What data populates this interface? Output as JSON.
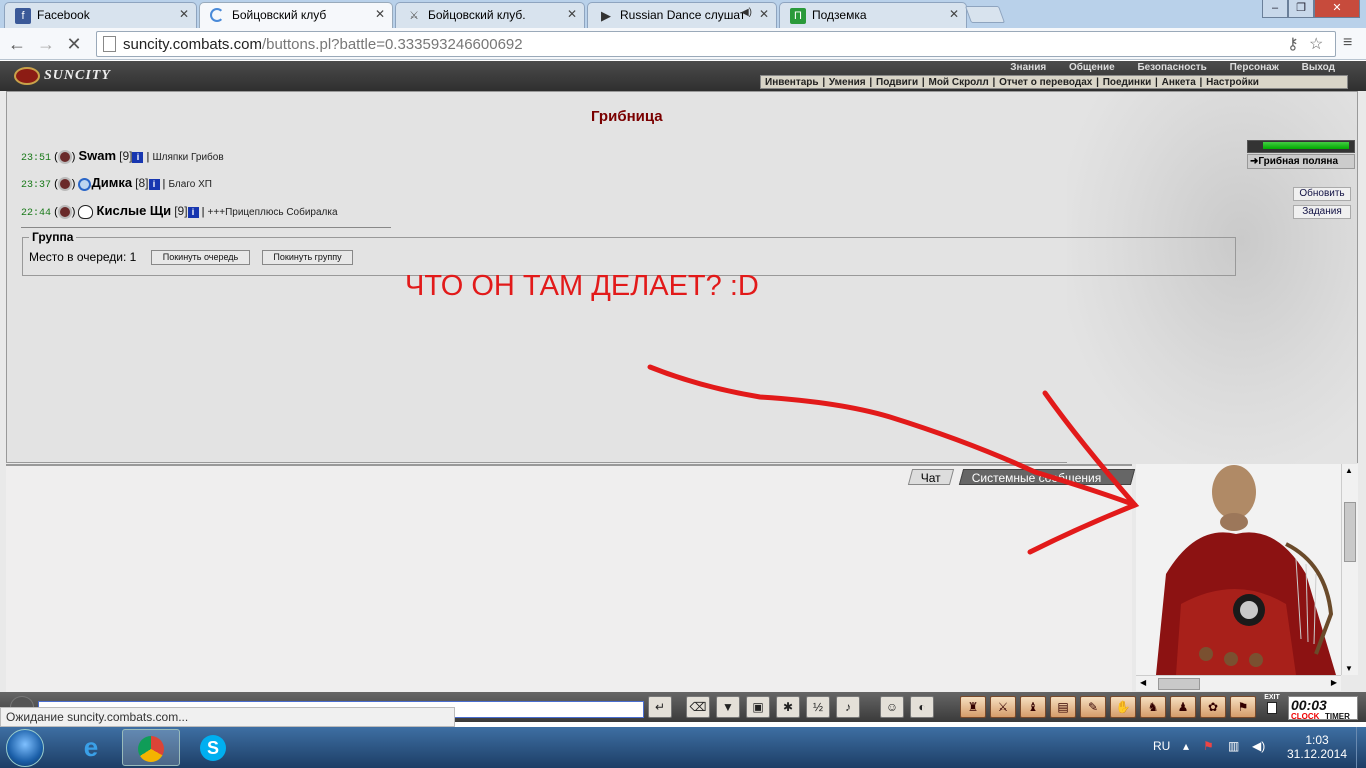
{
  "browser": {
    "tabs": [
      {
        "title": "Facebook",
        "icon": "facebook-icon"
      },
      {
        "title": "Бойцовский клуб",
        "icon": "loading-icon"
      },
      {
        "title": "Бойцовский клуб.",
        "icon": "swords-icon"
      },
      {
        "title": "Russian Dance слушат",
        "icon": "play-icon"
      },
      {
        "title": "Подземка",
        "icon": "page-icon"
      }
    ],
    "url_host": "suncity.combats.com",
    "url_path": "/buttons.pl?battle=0.333593246600692"
  },
  "game": {
    "logo": "SUNCITY",
    "top_nav": [
      "Знания",
      "Общение",
      "Безопасность",
      "Персонаж",
      "Выход"
    ],
    "sub_nav": [
      "Инвентарь",
      "Умения",
      "Подвиги",
      "Мой Скролл",
      "Отчет о переводах",
      "Поединки",
      "Анкета",
      "Настройки"
    ],
    "room_title": "Грибница",
    "location_name": "Грибная поляна",
    "buttons": {
      "refresh": "Обновить",
      "tasks": "Задания"
    },
    "players": [
      {
        "time": "23:51",
        "nick": "Swam",
        "level": "[9]",
        "desc": "Шляпки Грибов"
      },
      {
        "time": "23:37",
        "nick": "Димка",
        "level": "[8]",
        "desc": "Благо ХП"
      },
      {
        "time": "22:44",
        "nick": "Кислые Щи",
        "level": "[9]",
        "desc": "+++Прицеплюсь Собиралка"
      }
    ],
    "group": {
      "legend": "Группа",
      "queue_label": "Место в очереди: 1",
      "leave_queue": "Покинуть очередь",
      "leave_group": "Покинуть группу"
    },
    "annotation": "ЧТО ОН ТАМ ДЕЛАЕТ? :D",
    "chat_tabs": [
      "Чат",
      "Системные сообщения"
    ],
    "clock": {
      "time": "00:03",
      "clock_label": "CLOCK",
      "timer_label": "TIMER",
      "exit": "EXIT"
    }
  },
  "status_bar": "Ожидание suncity.combats.com...",
  "taskbar": {
    "language": "RU",
    "time": "1:03",
    "date": "31.12.2014"
  },
  "colors": {
    "annotation": "#e21a1a",
    "room_title": "#7a0000"
  }
}
